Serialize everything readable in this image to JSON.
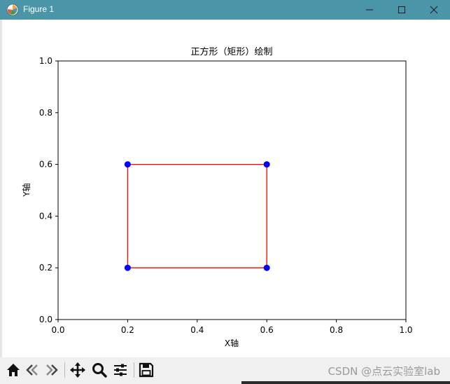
{
  "window": {
    "title": "Figure 1",
    "icons": [
      "matplotlib-logo-icon",
      "minimize-icon",
      "maximize-icon",
      "close-icon"
    ]
  },
  "toolbar": {
    "buttons": [
      "home-icon",
      "back-icon",
      "forward-icon",
      "pan-icon",
      "zoom-icon",
      "configure-subplots-icon",
      "save-icon"
    ]
  },
  "watermark": "CSDN @点云实验室lab",
  "chart_data": {
    "type": "line",
    "title": "正方形（矩形）绘制",
    "xlabel": "X轴",
    "ylabel": "Y轴",
    "xlim": [
      0.0,
      1.0
    ],
    "ylim": [
      0.0,
      1.0
    ],
    "xticks": [
      "0.0",
      "0.2",
      "0.4",
      "0.6",
      "0.8",
      "1.0"
    ],
    "yticks": [
      "0.0",
      "0.2",
      "0.4",
      "0.6",
      "0.8",
      "1.0"
    ],
    "grid": false,
    "series": [
      {
        "kind": "line",
        "color": "#ff0000",
        "x": [
          0.2,
          0.6,
          0.6,
          0.2,
          0.2
        ],
        "y": [
          0.2,
          0.2,
          0.6,
          0.6,
          0.2
        ]
      },
      {
        "kind": "scatter",
        "color": "#0000ff",
        "x": [
          0.2,
          0.6,
          0.6,
          0.2
        ],
        "y": [
          0.2,
          0.2,
          0.6,
          0.6
        ]
      }
    ]
  }
}
